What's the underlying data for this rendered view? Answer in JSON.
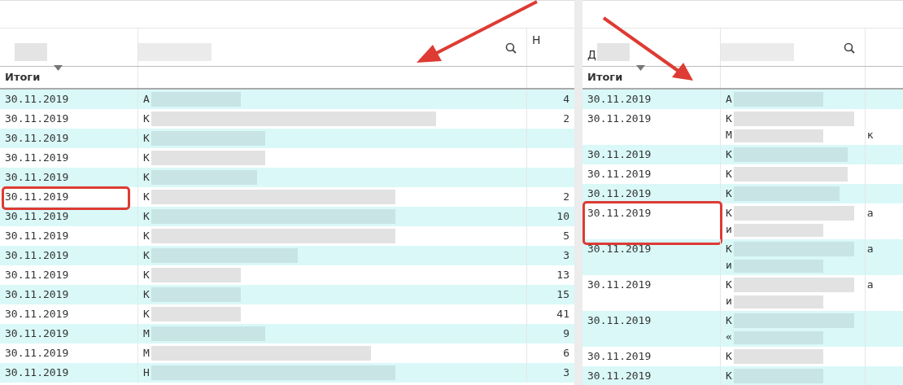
{
  "panels": [
    {
      "header": {
        "column_3": "Н"
      },
      "totals_label": "Итоги",
      "rows": [
        {
          "date": "30.11.2019",
          "name_lines": [
            [
              "А"
            ]
          ],
          "amount": "4",
          "circled": false
        },
        {
          "date": "30.11.2019",
          "name_lines": [
            [
              "К"
            ]
          ],
          "amount": "2",
          "circled": false
        },
        {
          "date": "30.11.2019",
          "name_lines": [
            [
              "К"
            ]
          ],
          "amount": "",
          "circled": false
        },
        {
          "date": "30.11.2019",
          "name_lines": [
            [
              "К"
            ]
          ],
          "amount": "",
          "circled": false
        },
        {
          "date": "30.11.2019",
          "name_lines": [
            [
              "К"
            ]
          ],
          "amount": "",
          "circled": false
        },
        {
          "date": "30.11.2019",
          "name_lines": [
            [
              "К"
            ]
          ],
          "amount": "2",
          "circled": true
        },
        {
          "date": "30.11.2019",
          "name_lines": [
            [
              "К"
            ]
          ],
          "amount": "10",
          "circled": false
        },
        {
          "date": "30.11.2019",
          "name_lines": [
            [
              "К"
            ]
          ],
          "amount": "5",
          "circled": false
        },
        {
          "date": "30.11.2019",
          "name_lines": [
            [
              "К"
            ]
          ],
          "amount": "3",
          "circled": false
        },
        {
          "date": "30.11.2019",
          "name_lines": [
            [
              "К"
            ]
          ],
          "amount": "13",
          "circled": false
        },
        {
          "date": "30.11.2019",
          "name_lines": [
            [
              "К"
            ]
          ],
          "amount": "15",
          "circled": false
        },
        {
          "date": "30.11.2019",
          "name_lines": [
            [
              "К"
            ]
          ],
          "amount": "41",
          "circled": false
        },
        {
          "date": "30.11.2019",
          "name_lines": [
            [
              "М"
            ]
          ],
          "amount": "9",
          "circled": false
        },
        {
          "date": "30.11.2019",
          "name_lines": [
            [
              "М"
            ]
          ],
          "amount": "6",
          "circled": false
        },
        {
          "date": "30.11.2019",
          "name_lines": [
            [
              "Н"
            ]
          ],
          "amount": "3",
          "circled": false
        }
      ]
    },
    {
      "header": {
        "column_1": "Д"
      },
      "totals_label": "Итоги",
      "rows": [
        {
          "date": "30.11.2019",
          "name_lines": [
            [
              "А"
            ]
          ],
          "amount": "",
          "circled": false
        },
        {
          "date": "30.11.2019",
          "name_lines": [
            [
              "К"
            ],
            [
              "М",
              "к"
            ]
          ],
          "amount": "",
          "circled": false
        },
        {
          "date": "30.11.2019",
          "name_lines": [
            [
              "К"
            ]
          ],
          "amount": "",
          "circled": false
        },
        {
          "date": "30.11.2019",
          "name_lines": [
            [
              "К"
            ]
          ],
          "amount": "",
          "circled": false
        },
        {
          "date": "30.11.2019",
          "name_lines": [
            [
              "К"
            ]
          ],
          "amount": "",
          "circled": false
        },
        {
          "date": "30.11.2019",
          "name_lines": [
            [
              "К",
              "а"
            ],
            [
              "и"
            ]
          ],
          "amount": "",
          "circled": true
        },
        {
          "date": "30.11.2019",
          "name_lines": [
            [
              "К",
              "а"
            ],
            [
              "и"
            ]
          ],
          "amount": "",
          "circled": false
        },
        {
          "date": "30.11.2019",
          "name_lines": [
            [
              "К",
              "а"
            ],
            [
              "и"
            ]
          ],
          "amount": "",
          "circled": false
        },
        {
          "date": "30.11.2019",
          "name_lines": [
            [
              "К"
            ],
            [
              "«"
            ]
          ],
          "amount": "",
          "circled": false
        },
        {
          "date": "30.11.2019",
          "name_lines": [
            [
              "К"
            ]
          ],
          "amount": "",
          "circled": false
        },
        {
          "date": "30.11.2019",
          "name_lines": [
            [
              "К"
            ]
          ],
          "amount": "",
          "circled": false
        }
      ]
    }
  ]
}
